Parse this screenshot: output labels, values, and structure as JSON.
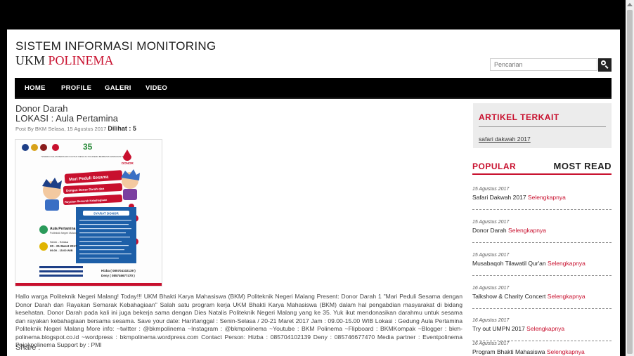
{
  "header": {
    "title": "SISTEM INFORMASI MONITORING",
    "subtitle_part1": "UKM ",
    "subtitle_part2": "POLINEMA",
    "search_placeholder": "Pencarian",
    "accent_color": "#c8102e"
  },
  "nav": {
    "items": [
      "HOME",
      "PROFILE",
      "GALERI",
      "VIDEO"
    ]
  },
  "post": {
    "title_line1": "Donor Darah",
    "title_line2": "LOKASI : Aula Pertamina",
    "meta": "Post By BKM Selasa, 15 Agustus 2017",
    "views": "Dilihat : 5",
    "body": "Hallo warga Politeknik Negeri Malang! Today!!! UKM Bhakti Karya Mahasiswa (BKM) Politeknik Negeri Malang Present: Donor Darah 1 \"Mari Peduli Sesama dengan Donor Darah dan Rayakan Semarak Kebahagiaan\" Salah satu program kerja UKM Bhakti Karya Mahasiswa (BKM) dalam hal pengabdian masyarakat di bidang kesehatan. Donor Darah pada kali ini juga bekerja sama dengan Dies Natalis Politeknik Negeri Malang yang ke 35. Yuk ikut mendonasikan darahmu untuk sesama dan rayakan kebahagiaan bersama sesama. Save your date: Hari/tanggal : Senin-Selasa / 20-21 Maret 2017 Jam : 09.00-15.00 WIB Lokasi : Gedung Aula Pertamina Politeknik Negeri Malang More info: ~twitter : @bkmpolinema ~Instagram : @bkmpolinema ~Youtube : BKM Polinema ~Flipboard : BKMKompak ~Blogger : bkm-polinema.blogspot.co.id ~wordpress : bkmpolinema.wordpress.com Contact Person: Hizba : 085704102139 Deny : 085746677470 Media partner : Eventpolinema Pojokpolinema Support by : PMI",
    "share_label": "Share :"
  },
  "poster": {
    "tagline": "\"SINERGI DALAM BERKARYA UNTUK MENUJU POLINEMA BERBASIS WAWASAN GLOBAL\"",
    "donor_label": "DONOR",
    "banner1": "Mari Peduli Sesama",
    "banner2": "Dengan Donor Darah dan",
    "banner3": "Rayakan Semarak Kebahagiaan",
    "syarat_title": "SYARAT DONOR",
    "loc_name": "Aula Pertamina",
    "loc_sub": "Politeknik Negeri Malang",
    "date_line1": "Senin - Selasa",
    "date_line2": "20 - 21 Maret 2017",
    "date_line3": "09.00 - 15.00 WIB",
    "cp1": "Hizba ( 085704102139 )",
    "cp2": "Deny ( 085746677470 )"
  },
  "sidebar": {
    "artikel_title": "ARTIKEL TERKAIT",
    "artikel_link": "safari dakwah 2017",
    "tab_popular": "POPULAR",
    "tab_most_read": "MOST READ",
    "more_label": "Selengkapnya",
    "popular": [
      {
        "date": "15 Agustus 2017",
        "title": "Safari Dakwah 2017"
      },
      {
        "date": "15 Agustus 2017",
        "title": "Donor Darah"
      },
      {
        "date": "15 Agustus 2017",
        "title": "Musabaqoh Tilawatil Qur'an"
      },
      {
        "date": "16 Agustus 2017",
        "title": "Talkshow & Charity Concert"
      },
      {
        "date": "16 Agustus 2017",
        "title": "Try out UMPN 2017"
      },
      {
        "date": "16 Agustus 2017",
        "title": "Program Bhakti Mahasiswa"
      }
    ]
  }
}
